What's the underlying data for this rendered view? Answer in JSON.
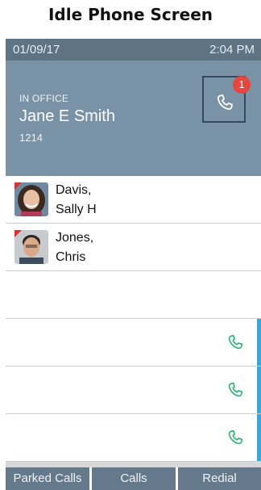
{
  "caption": "Idle Phone Screen",
  "status_bar": {
    "date": "01/09/17",
    "time": "2:04 PM"
  },
  "header": {
    "presence": "IN OFFICE",
    "user_name": "Jane E Smith",
    "extension": "1214",
    "missed_calls_badge": "1"
  },
  "contacts": [
    {
      "first_line": "Davis,",
      "second_line": "Sally H",
      "presence_color": "#d9342b"
    },
    {
      "first_line": "Jones,",
      "second_line": "Chris",
      "presence_color": "#d9342b"
    }
  ],
  "line_keys": [
    {
      "icon": "phone-icon",
      "color": "#2bb673"
    },
    {
      "icon": "phone-icon",
      "color": "#2bb673"
    },
    {
      "icon": "phone-icon",
      "color": "#2bb673"
    }
  ],
  "softkeys": [
    "Parked Calls",
    "Calls",
    "Redial"
  ],
  "colors": {
    "header": "#7a92a6",
    "status_bar": "#5e7384",
    "accent": "#29aee3",
    "badge": "#e8453c"
  }
}
